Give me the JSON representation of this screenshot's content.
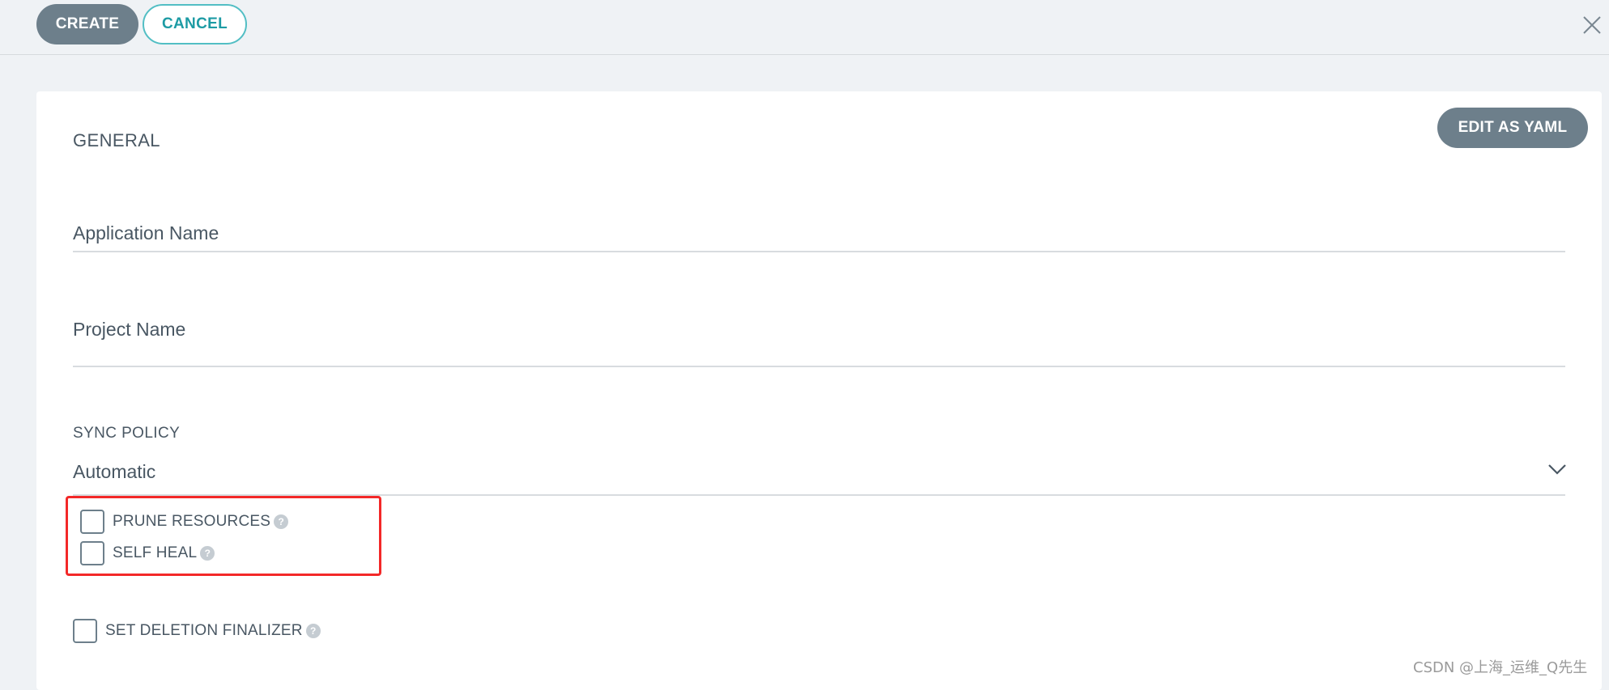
{
  "toolbar": {
    "create_label": "CREATE",
    "cancel_label": "CANCEL"
  },
  "panel": {
    "edit_yaml_label": "EDIT AS YAML",
    "general_title": "GENERAL",
    "application_name_label": "Application Name",
    "application_name_value": "",
    "project_name_label": "Project Name",
    "project_name_value": "",
    "sync_policy": {
      "title": "SYNC POLICY",
      "selected": "Automatic"
    },
    "options": [
      {
        "label": "PRUNE RESOURCES",
        "checked": false
      },
      {
        "label": "SELF HEAL",
        "checked": false
      }
    ],
    "deletion_finalizer": {
      "label": "SET DELETION FINALIZER",
      "checked": false
    }
  },
  "icons": {
    "close": "close-icon",
    "help": "question-circle-icon",
    "chevron": "chevron-down-icon"
  },
  "colors": {
    "primary_button": "#6d7f8b",
    "accent_teal": "#1d9ba4",
    "highlight_red": "#f32828",
    "background": "#eff2f5"
  },
  "watermark": "CSDN @上海_运维_Q先生"
}
